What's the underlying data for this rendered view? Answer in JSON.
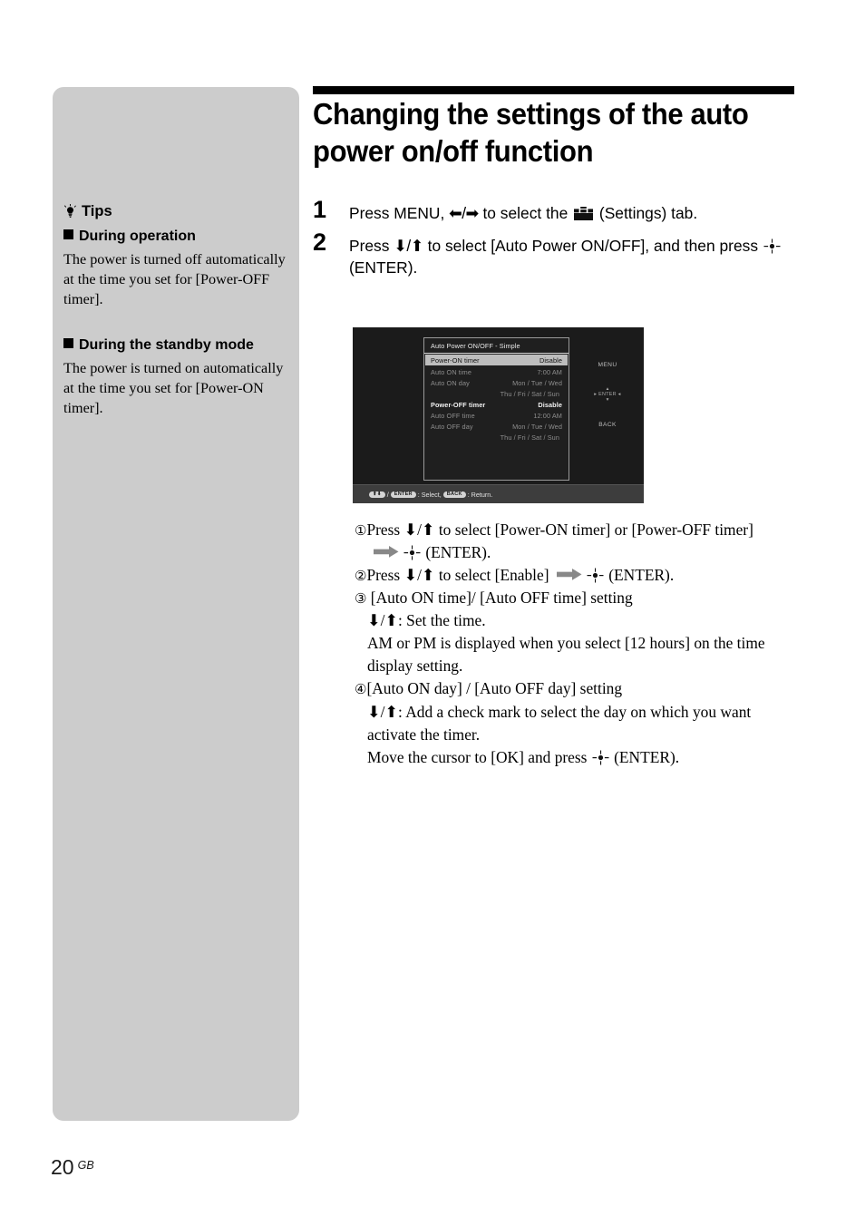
{
  "tips": {
    "heading": "Tips",
    "bulb_icon": "lightbulb-icon",
    "sections": [
      {
        "heading": "During operation",
        "body": "The power is turned off automatically at the time you set  for [Power-OFF timer]."
      },
      {
        "heading": "During the standby mode",
        "body": "The power is turned on automatically at the time you set for [Power-ON timer]."
      }
    ]
  },
  "main": {
    "title": "Changing the settings of the auto power on/off function",
    "steps": [
      {
        "number": "1",
        "text_a": "Press MENU, ",
        "arrows": "⬅/➡",
        "text_b": " to select the ",
        "icon": "toolbox-settings-icon",
        "text_c": " (Settings) tab."
      },
      {
        "number": "2",
        "text_a": "Press ",
        "arrows": "⬇/⬆",
        "text_b": " to select [Auto Power ON/OFF], and then press ",
        "icon": "enter-button-icon",
        "text_c": " (ENTER)."
      }
    ]
  },
  "osd": {
    "title": "Auto Power ON/OFF - Simple",
    "rows": [
      {
        "label": "Power-ON timer",
        "value": "Disable",
        "style": "sel"
      },
      {
        "label": "Auto ON time",
        "value": "7:00 AM",
        "style": "dim"
      },
      {
        "label": "Auto ON day",
        "value": "Mon / Tue / Wed",
        "style": "dim"
      },
      {
        "label": "",
        "value": "Thu /  Fri  /  Sat  /  Sun",
        "style": "days"
      },
      {
        "label": "Power-OFF timer",
        "value": "Disable",
        "style": "bright"
      },
      {
        "label": "Auto OFF time",
        "value": "12:00 AM",
        "style": "dim"
      },
      {
        "label": "Auto OFF day",
        "value": "Mon / Tue / Wed",
        "style": "dim"
      },
      {
        "label": "",
        "value": "Thu /  Fri  /  Sat  /  Sun",
        "style": "days"
      }
    ],
    "keys": {
      "menu": "MENU",
      "dpad_up": "▴",
      "dpad_center": "▸ ENTER ◂",
      "dpad_down": "▾",
      "back": "BACK"
    },
    "footer": {
      "updown_pill": "⬆⬇",
      "sep": " / ",
      "enter_pill": "ENTER",
      "select_text": ": Select, ",
      "back_pill": "BACK",
      "return_text": ": Return."
    }
  },
  "procedure": [
    {
      "marker": "①",
      "line1": "Press ⬇/⬆ to select [Power-ON timer] or [Power-OFF timer]",
      "line2_pre": "",
      "line2_post": " (ENTER)."
    },
    {
      "marker": "②",
      "line1_pre": "Press ⬇/⬆ to select [Enable] ",
      "line1_post": " (ENTER)."
    },
    {
      "marker": "③",
      "line1": " [Auto ON time]/ [Auto OFF time] setting",
      "line2": "⬇/⬆:  Set the time.",
      "line3": "AM or PM is displayed when you select [12 hours] on the time display setting."
    },
    {
      "marker": "④",
      "line1": "[Auto ON day] / [Auto OFF day] setting",
      "line2": "⬇/⬆: Add a check mark to select the day on which you want activate the timer.",
      "line3_pre": "Move the cursor to [OK] and press ",
      "line3_post": " (ENTER)."
    }
  ],
  "footer": {
    "page_number": "20",
    "region": "GB"
  }
}
